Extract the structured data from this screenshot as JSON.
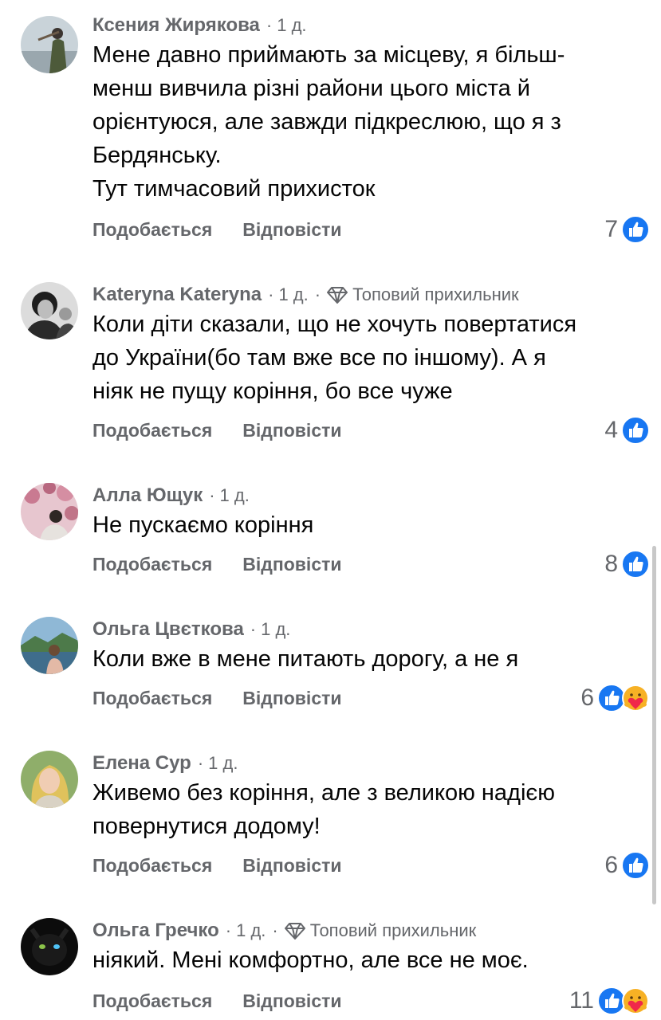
{
  "actions": {
    "like": "Подобається",
    "reply": "Відповісти"
  },
  "comments": [
    {
      "author": "Ксения Жирякова",
      "time": "1 д.",
      "badge": "",
      "lines": [
        "Мене давно приймають за місцеву, я більш-",
        "менш вивчила різні райони цього міста й",
        "орієнтуюся, але завжди підкреслюю, що я з",
        "Бердянську.",
        "Тут тимчасовий прихисток"
      ],
      "reaction_count": "7",
      "reactions": [
        "like-icon"
      ]
    },
    {
      "author": "Kateryna Kateryna",
      "time": "1 д.",
      "badge": "Топовий прихильник",
      "lines": [
        "Коли діти сказали, що не хочуть повертатися",
        "до України(бо там вже все по іншому). А я",
        "ніяк не пущу коріння, бо все чуже"
      ],
      "reaction_count": "4",
      "reactions": [
        "like-icon"
      ]
    },
    {
      "author": "Алла Ющук",
      "time": "1 д.",
      "badge": "",
      "lines": [
        "Не пускаємо коріння"
      ],
      "reaction_count": "8",
      "reactions": [
        "like-icon"
      ]
    },
    {
      "author": "Ольга Цвєткова",
      "time": "1 д.",
      "badge": "",
      "lines": [
        "Коли вже в мене питають дорогу, а не я"
      ],
      "reaction_count": "6",
      "reactions": [
        "like-icon",
        "care-icon"
      ]
    },
    {
      "author": "Елена Сур",
      "time": "1 д.",
      "badge": "",
      "lines": [
        "Живемо без коріння, але з великою надією",
        "повернутися додому!"
      ],
      "reaction_count": "6",
      "reactions": [
        "like-icon"
      ]
    },
    {
      "author": "Ольга Гречко",
      "time": "1 д.",
      "badge": "Топовий прихильник",
      "lines": [
        "ніякий. Мені комфортно, але все не моє."
      ],
      "reaction_count": "11",
      "reactions": [
        "like-icon",
        "care-icon"
      ]
    }
  ],
  "colors": {
    "like": "#1877f2",
    "care_face": "#f7b125",
    "care_heart": "#f0284a",
    "meta": "#65676b"
  }
}
